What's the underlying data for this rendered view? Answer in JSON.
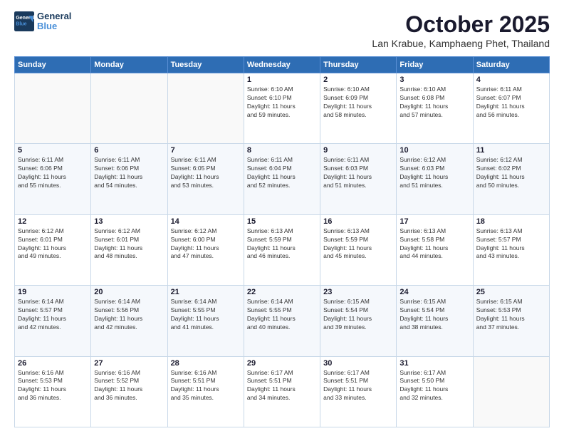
{
  "header": {
    "logo_line1": "General",
    "logo_line2": "Blue",
    "month": "October 2025",
    "location": "Lan Krabue, Kamphaeng Phet, Thailand"
  },
  "weekdays": [
    "Sunday",
    "Monday",
    "Tuesday",
    "Wednesday",
    "Thursday",
    "Friday",
    "Saturday"
  ],
  "weeks": [
    [
      {
        "day": "",
        "info": ""
      },
      {
        "day": "",
        "info": ""
      },
      {
        "day": "",
        "info": ""
      },
      {
        "day": "1",
        "info": "Sunrise: 6:10 AM\nSunset: 6:10 PM\nDaylight: 11 hours\nand 59 minutes."
      },
      {
        "day": "2",
        "info": "Sunrise: 6:10 AM\nSunset: 6:09 PM\nDaylight: 11 hours\nand 58 minutes."
      },
      {
        "day": "3",
        "info": "Sunrise: 6:10 AM\nSunset: 6:08 PM\nDaylight: 11 hours\nand 57 minutes."
      },
      {
        "day": "4",
        "info": "Sunrise: 6:11 AM\nSunset: 6:07 PM\nDaylight: 11 hours\nand 56 minutes."
      }
    ],
    [
      {
        "day": "5",
        "info": "Sunrise: 6:11 AM\nSunset: 6:06 PM\nDaylight: 11 hours\nand 55 minutes."
      },
      {
        "day": "6",
        "info": "Sunrise: 6:11 AM\nSunset: 6:06 PM\nDaylight: 11 hours\nand 54 minutes."
      },
      {
        "day": "7",
        "info": "Sunrise: 6:11 AM\nSunset: 6:05 PM\nDaylight: 11 hours\nand 53 minutes."
      },
      {
        "day": "8",
        "info": "Sunrise: 6:11 AM\nSunset: 6:04 PM\nDaylight: 11 hours\nand 52 minutes."
      },
      {
        "day": "9",
        "info": "Sunrise: 6:11 AM\nSunset: 6:03 PM\nDaylight: 11 hours\nand 51 minutes."
      },
      {
        "day": "10",
        "info": "Sunrise: 6:12 AM\nSunset: 6:03 PM\nDaylight: 11 hours\nand 51 minutes."
      },
      {
        "day": "11",
        "info": "Sunrise: 6:12 AM\nSunset: 6:02 PM\nDaylight: 11 hours\nand 50 minutes."
      }
    ],
    [
      {
        "day": "12",
        "info": "Sunrise: 6:12 AM\nSunset: 6:01 PM\nDaylight: 11 hours\nand 49 minutes."
      },
      {
        "day": "13",
        "info": "Sunrise: 6:12 AM\nSunset: 6:01 PM\nDaylight: 11 hours\nand 48 minutes."
      },
      {
        "day": "14",
        "info": "Sunrise: 6:12 AM\nSunset: 6:00 PM\nDaylight: 11 hours\nand 47 minutes."
      },
      {
        "day": "15",
        "info": "Sunrise: 6:13 AM\nSunset: 5:59 PM\nDaylight: 11 hours\nand 46 minutes."
      },
      {
        "day": "16",
        "info": "Sunrise: 6:13 AM\nSunset: 5:59 PM\nDaylight: 11 hours\nand 45 minutes."
      },
      {
        "day": "17",
        "info": "Sunrise: 6:13 AM\nSunset: 5:58 PM\nDaylight: 11 hours\nand 44 minutes."
      },
      {
        "day": "18",
        "info": "Sunrise: 6:13 AM\nSunset: 5:57 PM\nDaylight: 11 hours\nand 43 minutes."
      }
    ],
    [
      {
        "day": "19",
        "info": "Sunrise: 6:14 AM\nSunset: 5:57 PM\nDaylight: 11 hours\nand 42 minutes."
      },
      {
        "day": "20",
        "info": "Sunrise: 6:14 AM\nSunset: 5:56 PM\nDaylight: 11 hours\nand 42 minutes."
      },
      {
        "day": "21",
        "info": "Sunrise: 6:14 AM\nSunset: 5:55 PM\nDaylight: 11 hours\nand 41 minutes."
      },
      {
        "day": "22",
        "info": "Sunrise: 6:14 AM\nSunset: 5:55 PM\nDaylight: 11 hours\nand 40 minutes."
      },
      {
        "day": "23",
        "info": "Sunrise: 6:15 AM\nSunset: 5:54 PM\nDaylight: 11 hours\nand 39 minutes."
      },
      {
        "day": "24",
        "info": "Sunrise: 6:15 AM\nSunset: 5:54 PM\nDaylight: 11 hours\nand 38 minutes."
      },
      {
        "day": "25",
        "info": "Sunrise: 6:15 AM\nSunset: 5:53 PM\nDaylight: 11 hours\nand 37 minutes."
      }
    ],
    [
      {
        "day": "26",
        "info": "Sunrise: 6:16 AM\nSunset: 5:53 PM\nDaylight: 11 hours\nand 36 minutes."
      },
      {
        "day": "27",
        "info": "Sunrise: 6:16 AM\nSunset: 5:52 PM\nDaylight: 11 hours\nand 36 minutes."
      },
      {
        "day": "28",
        "info": "Sunrise: 6:16 AM\nSunset: 5:51 PM\nDaylight: 11 hours\nand 35 minutes."
      },
      {
        "day": "29",
        "info": "Sunrise: 6:17 AM\nSunset: 5:51 PM\nDaylight: 11 hours\nand 34 minutes."
      },
      {
        "day": "30",
        "info": "Sunrise: 6:17 AM\nSunset: 5:51 PM\nDaylight: 11 hours\nand 33 minutes."
      },
      {
        "day": "31",
        "info": "Sunrise: 6:17 AM\nSunset: 5:50 PM\nDaylight: 11 hours\nand 32 minutes."
      },
      {
        "day": "",
        "info": ""
      }
    ]
  ]
}
